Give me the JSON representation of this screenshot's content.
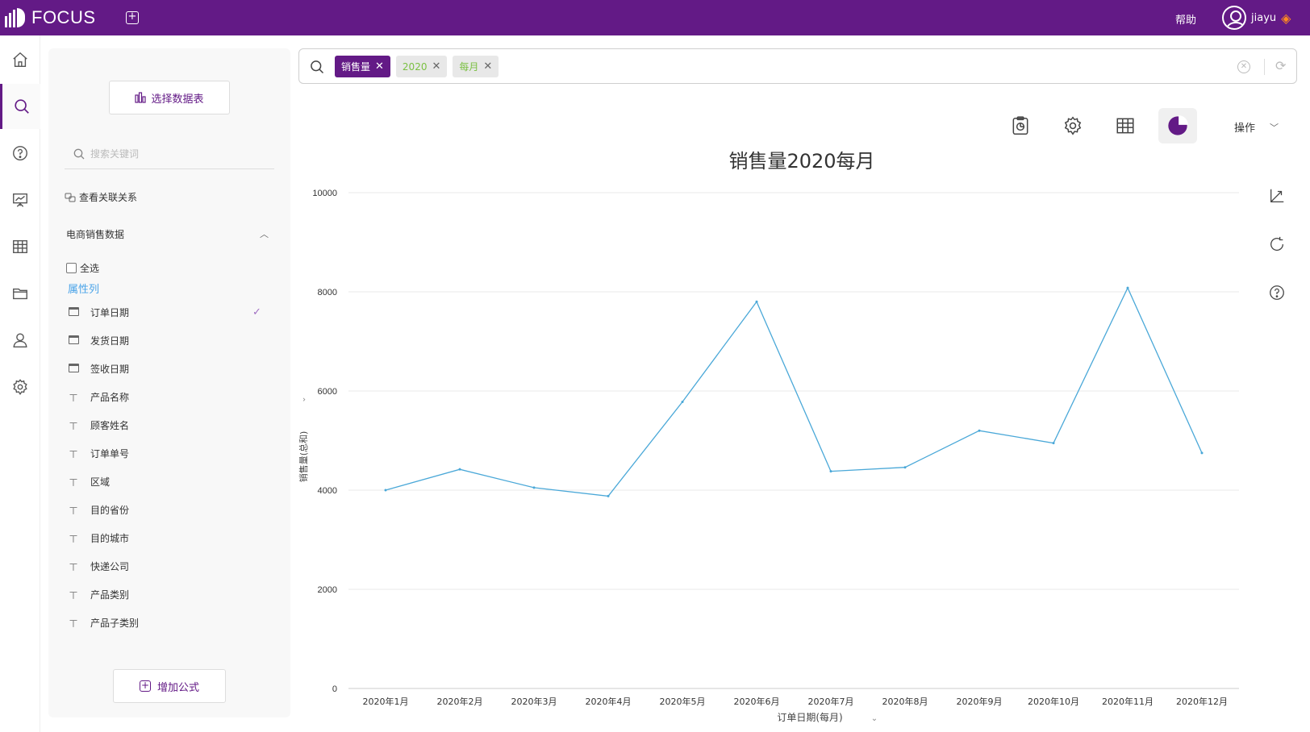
{
  "app": {
    "brand": "FOCUS",
    "help_label": "帮助",
    "user_name": "jiayu"
  },
  "nav": {
    "items": [
      "home-icon",
      "search-icon",
      "help-circle-icon",
      "presentation-icon",
      "table-icon",
      "folder-icon",
      "user-icon",
      "settings-icon"
    ],
    "active_index": 1
  },
  "panel": {
    "select_table_label": "选择数据表",
    "search_placeholder": "搜索关键词",
    "relations_label": "查看关联关系",
    "group_title": "电商销售数据",
    "select_all_label": "全选",
    "attr_title": "属性列",
    "fields": [
      {
        "label": "订单日期",
        "type": "date",
        "checked": true
      },
      {
        "label": "发货日期",
        "type": "date",
        "checked": false
      },
      {
        "label": "签收日期",
        "type": "date",
        "checked": false
      },
      {
        "label": "产品名称",
        "type": "text",
        "checked": false
      },
      {
        "label": "顾客姓名",
        "type": "text",
        "checked": false
      },
      {
        "label": "订单单号",
        "type": "text",
        "checked": false
      },
      {
        "label": "区域",
        "type": "text",
        "checked": false
      },
      {
        "label": "目的省份",
        "type": "text",
        "checked": false
      },
      {
        "label": "目的城市",
        "type": "text",
        "checked": false
      },
      {
        "label": "快递公司",
        "type": "text",
        "checked": false
      },
      {
        "label": "产品类别",
        "type": "text",
        "checked": false
      },
      {
        "label": "产品子类别",
        "type": "text",
        "checked": false
      }
    ],
    "add_formula_label": "增加公式"
  },
  "search": {
    "tokens": [
      {
        "label": "销售量",
        "kind": "measure"
      },
      {
        "label": "2020",
        "kind": "filter"
      },
      {
        "label": "每月",
        "kind": "filter"
      }
    ]
  },
  "toolbar": {
    "ops_label": "操作"
  },
  "chart_data": {
    "type": "line",
    "title": "销售量2020每月",
    "xlabel": "订单日期(每月)",
    "ylabel": "销售量(总和)",
    "categories": [
      "2020年1月",
      "2020年2月",
      "2020年3月",
      "2020年4月",
      "2020年5月",
      "2020年6月",
      "2020年7月",
      "2020年8月",
      "2020年9月",
      "2020年10月",
      "2020年11月",
      "2020年12月"
    ],
    "series": [
      {
        "values": [
          4000,
          4420,
          4050,
          3880,
          5780,
          7800,
          4380,
          4460,
          5200,
          4950,
          8080,
          4750
        ],
        "color": "#4aa8d8"
      }
    ],
    "ylim": [
      0,
      10000
    ],
    "yticks": [
      0,
      2000,
      4000,
      6000,
      8000,
      10000
    ],
    "grid": true
  }
}
